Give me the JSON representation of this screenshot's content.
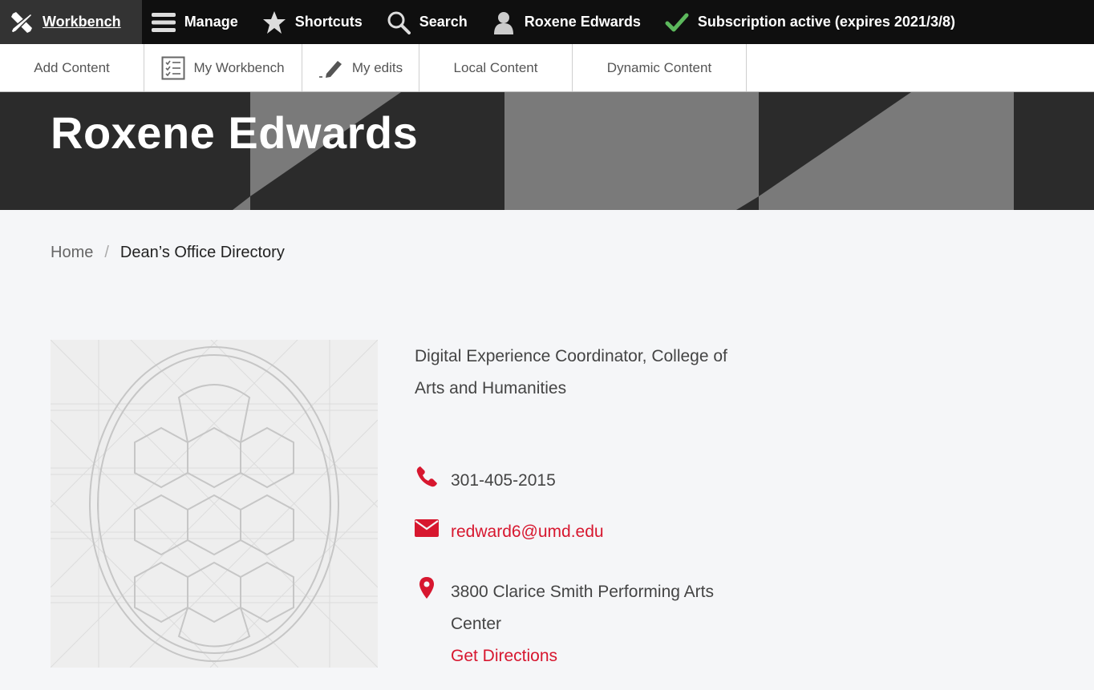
{
  "toolbar": {
    "items": [
      {
        "label": "Workbench",
        "icon": "workbench-icon"
      },
      {
        "label": "Manage",
        "icon": "hamburger-icon"
      },
      {
        "label": "Shortcuts",
        "icon": "star-icon"
      },
      {
        "label": "Search",
        "icon": "search-icon"
      },
      {
        "label": "Roxene Edwards",
        "icon": "user-icon"
      },
      {
        "label": "Subscription active (expires 2021/3/8)",
        "icon": "check-icon"
      }
    ]
  },
  "tray": {
    "items": [
      {
        "label": "Add Content"
      },
      {
        "label": "My Workbench",
        "icon": "checklist-icon"
      },
      {
        "label": "My edits",
        "icon": "pencil-icon"
      },
      {
        "label": "Local Content"
      },
      {
        "label": "Dynamic Content"
      }
    ]
  },
  "hero": {
    "title": "Roxene Edwards"
  },
  "breadcrumb": {
    "home": "Home",
    "separator": "/",
    "current": "Dean’s Office Directory"
  },
  "profile": {
    "job_title": "Digital Experience Coordinator, College of Arts and Humanities",
    "phone": "301-405-2015",
    "email": "redward6@umd.edu",
    "address": "3800 Clarice Smith Performing Arts Center",
    "directions_label": "Get Directions"
  },
  "colors": {
    "accent": "#d7172f",
    "toolbar_bg": "#0f0f0f",
    "check": "#5cb85c"
  }
}
